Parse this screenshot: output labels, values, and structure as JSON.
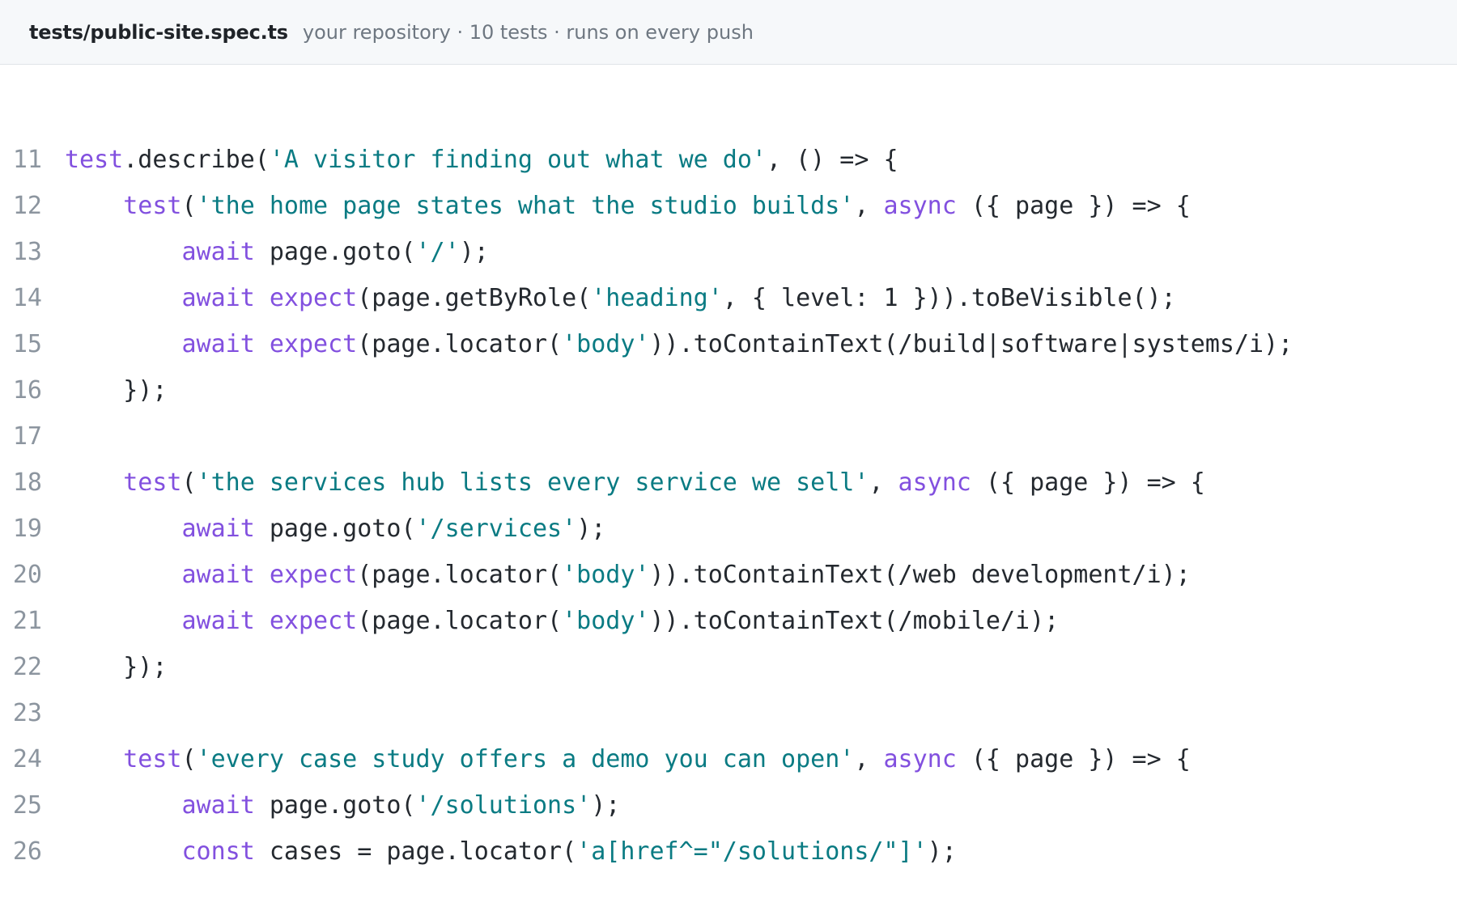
{
  "header": {
    "filename": "tests/public-site.spec.ts",
    "meta": "your repository · 10 tests · runs on every push"
  },
  "code": {
    "lines": [
      {
        "n": "11",
        "tokens": [
          {
            "t": "fn",
            "v": "test"
          },
          {
            "t": "pl",
            "v": ".describe("
          },
          {
            "t": "str",
            "v": "'A visitor finding out what we do'"
          },
          {
            "t": "pl",
            "v": ", () => {"
          }
        ]
      },
      {
        "n": "12",
        "tokens": [
          {
            "t": "pl",
            "v": "    "
          },
          {
            "t": "fn",
            "v": "test"
          },
          {
            "t": "pl",
            "v": "("
          },
          {
            "t": "str",
            "v": "'the home page states what the studio builds'"
          },
          {
            "t": "pl",
            "v": ", "
          },
          {
            "t": "kw",
            "v": "async"
          },
          {
            "t": "pl",
            "v": " ({ page }) => {"
          }
        ]
      },
      {
        "n": "13",
        "tokens": [
          {
            "t": "pl",
            "v": "        "
          },
          {
            "t": "kw",
            "v": "await"
          },
          {
            "t": "pl",
            "v": " page.goto("
          },
          {
            "t": "str",
            "v": "'/'"
          },
          {
            "t": "pl",
            "v": ");"
          }
        ]
      },
      {
        "n": "14",
        "tokens": [
          {
            "t": "pl",
            "v": "        "
          },
          {
            "t": "kw",
            "v": "await"
          },
          {
            "t": "pl",
            "v": " "
          },
          {
            "t": "fn",
            "v": "expect"
          },
          {
            "t": "pl",
            "v": "(page.getByRole("
          },
          {
            "t": "str",
            "v": "'heading'"
          },
          {
            "t": "pl",
            "v": ", { level: 1 })).toBeVisible();"
          }
        ]
      },
      {
        "n": "15",
        "tokens": [
          {
            "t": "pl",
            "v": "        "
          },
          {
            "t": "kw",
            "v": "await"
          },
          {
            "t": "pl",
            "v": " "
          },
          {
            "t": "fn",
            "v": "expect"
          },
          {
            "t": "pl",
            "v": "(page.locator("
          },
          {
            "t": "str",
            "v": "'body'"
          },
          {
            "t": "pl",
            "v": ")).toContainText(/build|software|systems/i);"
          }
        ]
      },
      {
        "n": "16",
        "tokens": [
          {
            "t": "pl",
            "v": "    });"
          }
        ]
      },
      {
        "n": "17",
        "tokens": []
      },
      {
        "n": "18",
        "tokens": [
          {
            "t": "pl",
            "v": "    "
          },
          {
            "t": "fn",
            "v": "test"
          },
          {
            "t": "pl",
            "v": "("
          },
          {
            "t": "str",
            "v": "'the services hub lists every service we sell'"
          },
          {
            "t": "pl",
            "v": ", "
          },
          {
            "t": "kw",
            "v": "async"
          },
          {
            "t": "pl",
            "v": " ({ page }) => {"
          }
        ]
      },
      {
        "n": "19",
        "tokens": [
          {
            "t": "pl",
            "v": "        "
          },
          {
            "t": "kw",
            "v": "await"
          },
          {
            "t": "pl",
            "v": " page.goto("
          },
          {
            "t": "str",
            "v": "'/services'"
          },
          {
            "t": "pl",
            "v": ");"
          }
        ]
      },
      {
        "n": "20",
        "tokens": [
          {
            "t": "pl",
            "v": "        "
          },
          {
            "t": "kw",
            "v": "await"
          },
          {
            "t": "pl",
            "v": " "
          },
          {
            "t": "fn",
            "v": "expect"
          },
          {
            "t": "pl",
            "v": "(page.locator("
          },
          {
            "t": "str",
            "v": "'body'"
          },
          {
            "t": "pl",
            "v": ")).toContainText(/web development/i);"
          }
        ]
      },
      {
        "n": "21",
        "tokens": [
          {
            "t": "pl",
            "v": "        "
          },
          {
            "t": "kw",
            "v": "await"
          },
          {
            "t": "pl",
            "v": " "
          },
          {
            "t": "fn",
            "v": "expect"
          },
          {
            "t": "pl",
            "v": "(page.locator("
          },
          {
            "t": "str",
            "v": "'body'"
          },
          {
            "t": "pl",
            "v": ")).toContainText(/mobile/i);"
          }
        ]
      },
      {
        "n": "22",
        "tokens": [
          {
            "t": "pl",
            "v": "    });"
          }
        ]
      },
      {
        "n": "23",
        "tokens": []
      },
      {
        "n": "24",
        "tokens": [
          {
            "t": "pl",
            "v": "    "
          },
          {
            "t": "fn",
            "v": "test"
          },
          {
            "t": "pl",
            "v": "("
          },
          {
            "t": "str",
            "v": "'every case study offers a demo you can open'"
          },
          {
            "t": "pl",
            "v": ", "
          },
          {
            "t": "kw",
            "v": "async"
          },
          {
            "t": "pl",
            "v": " ({ page }) => {"
          }
        ]
      },
      {
        "n": "25",
        "tokens": [
          {
            "t": "pl",
            "v": "        "
          },
          {
            "t": "kw",
            "v": "await"
          },
          {
            "t": "pl",
            "v": " page.goto("
          },
          {
            "t": "str",
            "v": "'/solutions'"
          },
          {
            "t": "pl",
            "v": ");"
          }
        ]
      },
      {
        "n": "26",
        "tokens": [
          {
            "t": "pl",
            "v": "        "
          },
          {
            "t": "kw",
            "v": "const"
          },
          {
            "t": "pl",
            "v": " cases = page.locator("
          },
          {
            "t": "str",
            "v": "'a[href^=\"/solutions/\"]'"
          },
          {
            "t": "pl",
            "v": ");"
          }
        ]
      }
    ]
  },
  "colors": {
    "keyword": "#8250df",
    "string": "#0a7b83",
    "plain": "#24292f",
    "line_number": "#8c959f",
    "header_bg": "#f6f8fa"
  }
}
